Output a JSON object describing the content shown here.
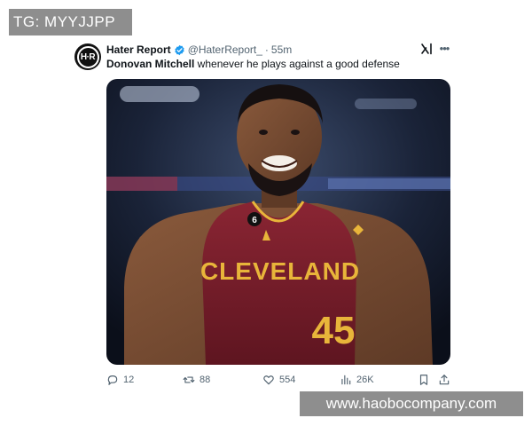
{
  "watermarks": {
    "top": "TG: MYYJJPP",
    "bottom": "www.haobocompany.com"
  },
  "tweet": {
    "author_name": "Hater Report",
    "handle": "@HaterReport_",
    "separator": "·",
    "time": "55m",
    "text_bold": "Donovan Mitchell",
    "text_rest": " whenever he plays against a good defense",
    "avatar_mark": "H·R"
  },
  "media": {
    "jersey_text": "CLEVELAND",
    "jersey_number": "45",
    "patch_number": "6"
  },
  "actions": {
    "replies": "12",
    "reposts": "88",
    "likes": "554",
    "views": "26K"
  },
  "icons": [
    "verified-badge-icon",
    "grok-icon",
    "more-icon",
    "reply-icon",
    "repost-icon",
    "like-icon",
    "views-icon",
    "bookmark-icon",
    "share-icon"
  ],
  "colors": {
    "verified": "#1d9bf0",
    "jersey": "#7a1f2b",
    "jersey_text": "#e8b53a",
    "muted": "#536471"
  }
}
